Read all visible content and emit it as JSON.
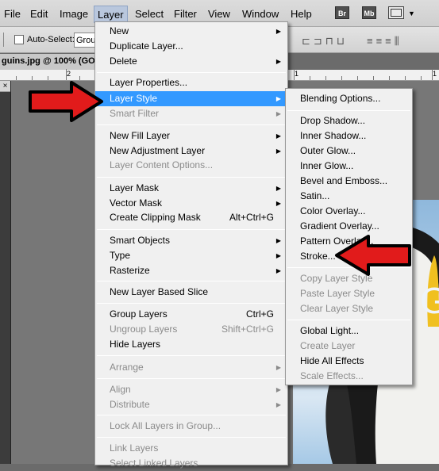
{
  "menubar": {
    "items": [
      {
        "label": "File"
      },
      {
        "label": "Edit"
      },
      {
        "label": "Image"
      },
      {
        "label": "Layer"
      },
      {
        "label": "Select"
      },
      {
        "label": "Filter"
      },
      {
        "label": "View"
      },
      {
        "label": "Window"
      },
      {
        "label": "Help"
      }
    ],
    "br_label": "Br",
    "mb_label": "Mb"
  },
  "options": {
    "auto_select_label": "Auto-Select:",
    "auto_select_value": "Grou"
  },
  "document": {
    "tab_title": "guins.jpg @ 100% (GO"
  },
  "ruler": {
    "labels": [
      "2",
      "1",
      "1"
    ]
  },
  "canvas": {
    "overlay_text": "GO"
  },
  "layer_menu": {
    "new": "New",
    "duplicate": "Duplicate Layer...",
    "delete": "Delete",
    "properties": "Layer Properties...",
    "layer_style": "Layer Style",
    "smart_filter": "Smart Filter",
    "new_fill": "New Fill Layer",
    "new_adjustment": "New Adjustment Layer",
    "content_options": "Layer Content Options...",
    "layer_mask": "Layer Mask",
    "vector_mask": "Vector Mask",
    "clipping_mask": "Create Clipping Mask",
    "clipping_shortcut": "Alt+Ctrl+G",
    "smart_objects": "Smart Objects",
    "type": "Type",
    "rasterize": "Rasterize",
    "slice": "New Layer Based Slice",
    "group": "Group Layers",
    "group_shortcut": "Ctrl+G",
    "ungroup": "Ungroup Layers",
    "ungroup_shortcut": "Shift+Ctrl+G",
    "hide": "Hide Layers",
    "arrange": "Arrange",
    "align": "Align",
    "distribute": "Distribute",
    "lock_all": "Lock All Layers in Group...",
    "link": "Link Layers",
    "select_linked": "Select Linked Layers"
  },
  "style_menu": {
    "blending": "Blending Options...",
    "drop_shadow": "Drop Shadow...",
    "inner_shadow": "Inner Shadow...",
    "outer_glow": "Outer Glow...",
    "inner_glow": "Inner Glow...",
    "bevel": "Bevel and Emboss...",
    "satin": "Satin...",
    "color_overlay": "Color Overlay...",
    "gradient_overlay": "Gradient Overlay...",
    "pattern_overlay": "Pattern Overlay...",
    "stroke": "Stroke...",
    "copy_style": "Copy Layer Style",
    "paste_style": "Paste Layer Style",
    "clear_style": "Clear Layer Style",
    "global_light": "Global Light...",
    "create_layer": "Create Layer",
    "hide_effects": "Hide All Effects",
    "scale_effects": "Scale Effects..."
  },
  "colors": {
    "highlight": "#3399ff",
    "annotation_arrow": "#e11b1b",
    "menu_bg": "#f0f0f0"
  },
  "icons": [
    "submenu-arrow-icon",
    "red-arrow-icon",
    "window-control-icon"
  ]
}
